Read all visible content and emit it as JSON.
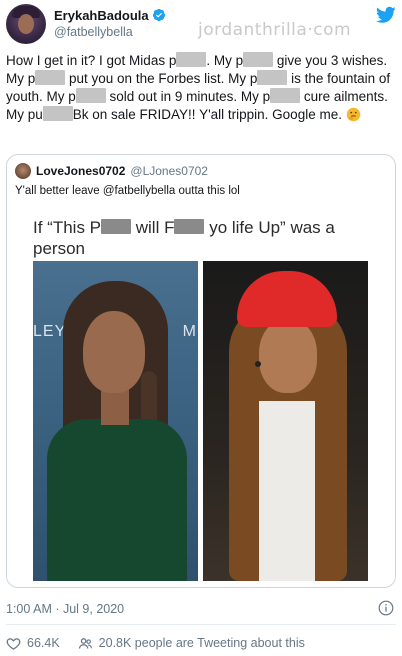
{
  "author": {
    "display_name": "ErykahBadoula",
    "handle": "@fatbellybella",
    "verified": true
  },
  "watermark": "jordanthrilla·com",
  "tweet": {
    "segments": [
      "How I get in it? I got Midas p",
      ". My p",
      " give you 3 wishes. My p",
      " put you on the Forbes list. My p",
      " is the fountain of youth. My p",
      " sold out in 9 minutes. My p",
      " cure ailments. My pu",
      "Bk on sale FRIDAY!! Y'all trippin. Google me. "
    ],
    "emoji_icon": "thinking-face-icon"
  },
  "quote": {
    "display_name": "LoveJones0702",
    "handle": "@LJones0702",
    "text": "Y'all better leave @fatbellybella outta this lol",
    "meme_caption_parts": [
      "If “This P",
      " will F",
      " yo life Up” was a person"
    ],
    "sign_left": "LEY C",
    "sign_right": "M"
  },
  "timestamp": "1:00 AM · Jul 9, 2020",
  "actions": {
    "likes": "66.4K",
    "talking": "20.8K people are Tweeting about this"
  },
  "colors": {
    "twitter_blue": "#1da1f2",
    "text": "#14171a",
    "secondary": "#657786",
    "border": "#ccd6dd"
  }
}
